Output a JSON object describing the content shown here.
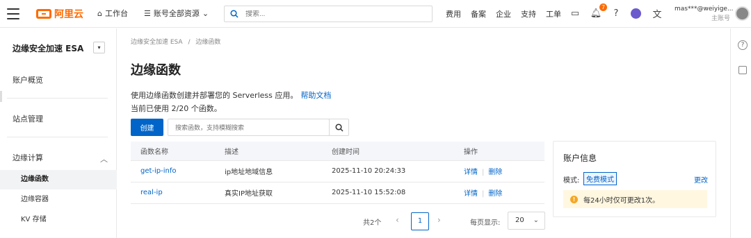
{
  "header": {
    "logo_text": "阿里云",
    "workbench": "工作台",
    "account_resources": "账号全部资源",
    "search_placeholder": "搜索...",
    "nav": [
      "费用",
      "备案",
      "企业",
      "支持",
      "工单"
    ],
    "notification_count": "7",
    "user_name": "mas***@weiyige...",
    "user_role": "主账号"
  },
  "sidebar": {
    "product": "边缘安全加速 ESA",
    "items": {
      "overview": "账户概览",
      "site_mgmt": "站点管理",
      "edge_compute": "边缘计算",
      "edge_functions": "边缘函数",
      "edge_containers": "边缘容器",
      "kv_storage": "KV 存储"
    }
  },
  "main": {
    "breadcrumb_root": "边缘安全加速 ESA",
    "breadcrumb_sep": "/",
    "breadcrumb_current": "边缘函数",
    "title": "边缘函数",
    "description": "使用边缘函数创建并部署您的 Serverless 应用。",
    "help_link": "帮助文档",
    "usage": "当前已使用 2/20 个函数。",
    "create_label": "创建",
    "search_placeholder": "搜索函数，支持模糊搜索",
    "table": {
      "headers": [
        "函数名称",
        "描述",
        "创建时间",
        "操作"
      ],
      "rows": [
        {
          "name": "get-ip-info",
          "desc": "ip地址地域信息",
          "created": "2025-11-10 20:24:33",
          "detail": "详情",
          "delete": "删除"
        },
        {
          "name": "real-ip",
          "desc": "真实IP地址获取",
          "created": "2025-11-10 15:52:08",
          "detail": "详情",
          "delete": "删除"
        }
      ]
    },
    "pagination": {
      "total": "共2个",
      "current_page": "1",
      "page_size_label": "每页显示:",
      "page_size": "20"
    }
  },
  "account_panel": {
    "title": "账户信息",
    "mode_label": "模式:",
    "mode_value": "免费模式",
    "change": "更改",
    "notice": "每24小时仅可更改1次。"
  },
  "colors": {
    "brand": "#ff6a00",
    "primary": "#0064c8",
    "notice_bg": "#fff7e0"
  }
}
